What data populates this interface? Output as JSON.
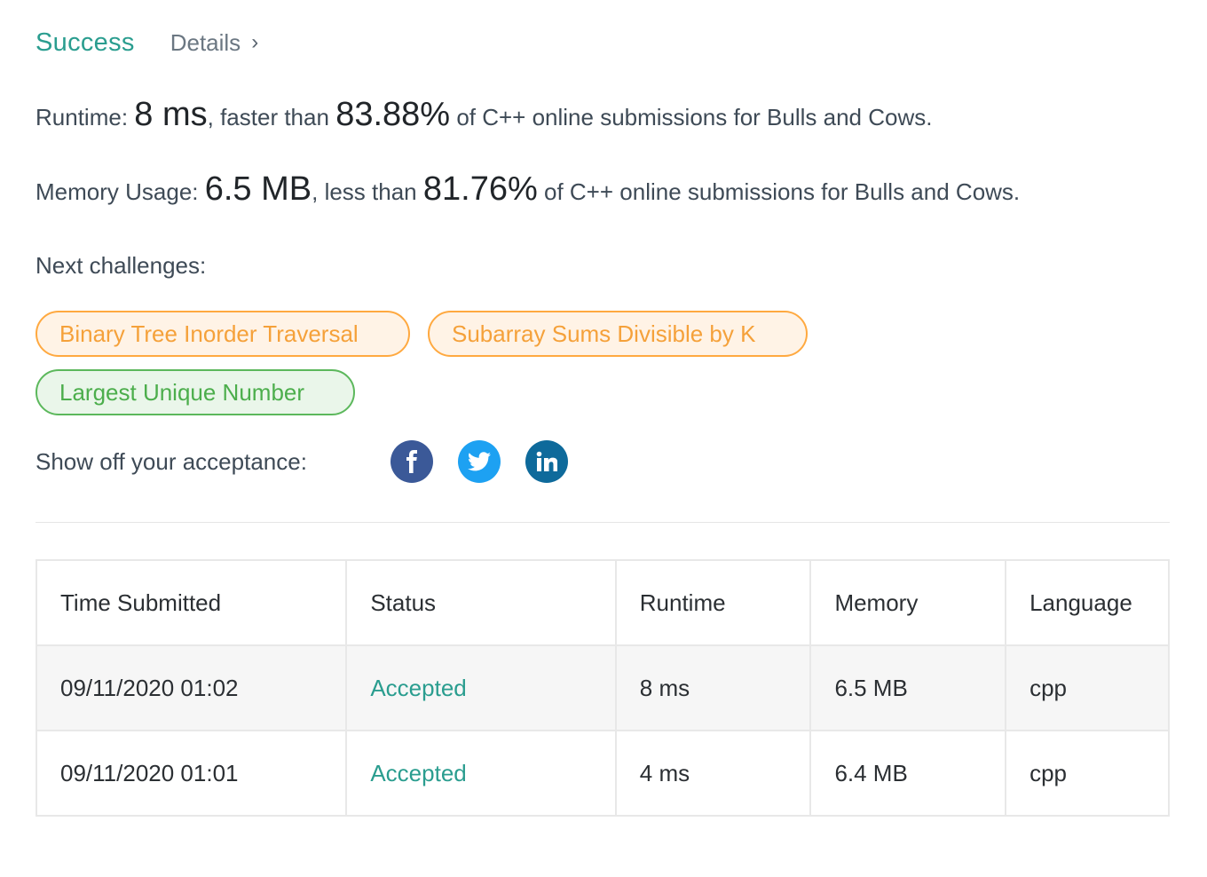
{
  "header": {
    "status": "Success",
    "details_label": "Details",
    "details_chevron": "›"
  },
  "runtime": {
    "label": "Runtime:",
    "value": "8 ms",
    "comparison": ", faster than",
    "percent": "83.88%",
    "suffix": "of C++ online submissions for Bulls and Cows."
  },
  "memory": {
    "label": "Memory Usage:",
    "value": "6.5 MB",
    "comparison": ", less than",
    "percent": "81.76%",
    "suffix": "of C++ online submissions for Bulls and Cows."
  },
  "next_challenges": {
    "label": "Next challenges:",
    "items": [
      {
        "label": "Binary Tree Inorder Traversal",
        "difficulty_color": "#ffa940"
      },
      {
        "label": "Subarray Sums Divisible by K",
        "difficulty_color": "#ffa940"
      },
      {
        "label": "Largest Unique Number",
        "difficulty_color": "#5cb85c"
      }
    ]
  },
  "share": {
    "label": "Show off your acceptance:",
    "icons": [
      "facebook-icon",
      "twitter-icon",
      "linkedin-icon"
    ]
  },
  "submissions": {
    "columns": [
      "Time Submitted",
      "Status",
      "Runtime",
      "Memory",
      "Language"
    ],
    "rows": [
      {
        "time": "09/11/2020 01:02",
        "status": "Accepted",
        "runtime": "8 ms",
        "memory": "6.5 MB",
        "language": "cpp"
      },
      {
        "time": "09/11/2020 01:01",
        "status": "Accepted",
        "runtime": "4 ms",
        "memory": "6.4 MB",
        "language": "cpp"
      }
    ]
  },
  "colors": {
    "accent": "#2a9d8f",
    "medium": "#ffa940",
    "easy": "#5cb85c"
  }
}
